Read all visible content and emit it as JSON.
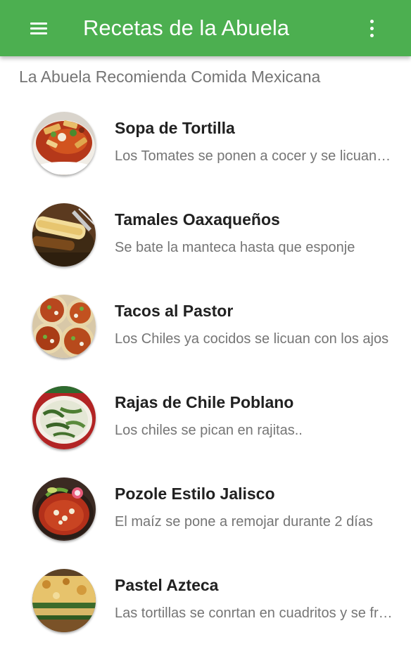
{
  "app_bar": {
    "title": "Recetas de la Abuela",
    "color": "#4caf50",
    "menu_icon": "hamburger-menu-icon",
    "overflow_icon": "more-vertical-icon"
  },
  "section_header": "La Abuela Recomienda Comida Mexicana",
  "recipes": [
    {
      "title": "Sopa de Tortilla",
      "description": "Los Tomates se ponen a cocer y se licuan con cebolla",
      "thumbnail": "sopa-de-tortilla-photo"
    },
    {
      "title": "Tamales Oaxaqueños",
      "description": "Se bate la manteca hasta que esponje",
      "thumbnail": "tamales-oaxaquenos-photo"
    },
    {
      "title": "Tacos al Pastor",
      "description": "Los Chiles ya cocidos se licuan con los ajos",
      "thumbnail": "tacos-al-pastor-photo"
    },
    {
      "title": "Rajas de Chile Poblano",
      "description": "Los chiles se pican en rajitas..",
      "thumbnail": "rajas-de-chile-poblano-photo"
    },
    {
      "title": "Pozole Estilo Jalisco",
      "description": "El maíz se pone a remojar durante 2 días",
      "thumbnail": "pozole-estilo-jalisco-photo"
    },
    {
      "title": "Pastel Azteca",
      "description": "Las tortillas se conrtan en cuadritos y se fríen",
      "thumbnail": "pastel-azteca-photo"
    }
  ]
}
